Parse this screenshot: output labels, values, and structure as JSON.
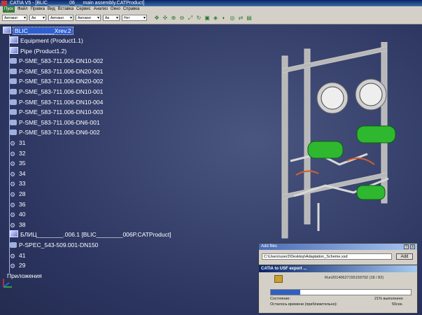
{
  "window": {
    "title": "CATIA V5 - [BLIC________06___main assembly.CATProduct]"
  },
  "menu": [
    "Пуск",
    "Файл",
    "Правка",
    "Вид",
    "Вставка",
    "Сервис",
    "Анализ",
    "Окно",
    "Справка"
  ],
  "toolbar": {
    "combos": [
      "Автомат",
      "Ав",
      "Автомат",
      "Автомат",
      "Ав",
      "Нет"
    ],
    "icons": [
      "move-icon",
      "pan-icon",
      "zoom-in-icon",
      "zoom-out-icon",
      "fit-icon",
      "rotate-icon",
      "normal-view-icon",
      "iso-view-icon",
      "render-icon",
      "hide-show-icon",
      "swap-icon",
      "spec-icon"
    ]
  },
  "tree": {
    "root": "BLIC________Xrev.2",
    "items": [
      {
        "label": "Equipment (Product1.1)",
        "icon": "product"
      },
      {
        "label": "Pipe (Product1.2)",
        "icon": "product"
      },
      {
        "label": "P-SME_583-711.006-DN10-002",
        "icon": "part"
      },
      {
        "label": "P-SME_583-711.006-DN20-001",
        "icon": "part"
      },
      {
        "label": "P-SME_583-711.006-DN20-002",
        "icon": "part"
      },
      {
        "label": "P-SME_583-711.006-DN10-001",
        "icon": "part"
      },
      {
        "label": "P-SME_583-711.006-DN10-004",
        "icon": "part"
      },
      {
        "label": "P-SME_583-711.006-DN10-003",
        "icon": "part"
      },
      {
        "label": "P-SME_583-711.006-DN6-001",
        "icon": "part"
      },
      {
        "label": "P-SME_583-711.006-DN6-002",
        "icon": "part"
      },
      {
        "label": "31",
        "icon": "gear"
      },
      {
        "label": "32",
        "icon": "gear"
      },
      {
        "label": "35",
        "icon": "gear"
      },
      {
        "label": "34",
        "icon": "gear"
      },
      {
        "label": "33",
        "icon": "gear"
      },
      {
        "label": "28",
        "icon": "gear"
      },
      {
        "label": "36",
        "icon": "gear"
      },
      {
        "label": "40",
        "icon": "gear"
      },
      {
        "label": "38",
        "icon": "gear"
      },
      {
        "label": "БЛИЦ________.006.1 [BLIC________006P.CATProduct]",
        "icon": "product"
      },
      {
        "label": "P-SPEC_543-509.001-DN150",
        "icon": "part"
      },
      {
        "label": "41",
        "icon": "gear"
      },
      {
        "label": "29",
        "icon": "gear"
      }
    ],
    "footer": "Приложения"
  },
  "add_files": {
    "title": "Add files",
    "path": "C:\\Users\\user2\\Desktop\\Adaptation_Scheme.xsd",
    "add_label": "Add",
    "help": "?",
    "close": "X"
  },
  "export": {
    "title": "CATIA to USF export ...",
    "run": "Run20140627155159792 (18 / 82)",
    "progress": 0.21,
    "state_label": "Состояние:",
    "state_value": "21% выполнено",
    "remaining_label": "Осталось времени (приблизительно):",
    "remaining_value": "50сек."
  },
  "colors": {
    "viewport": "#2b3560",
    "selection": "#3060d0",
    "equipment": "#2fb82f"
  }
}
